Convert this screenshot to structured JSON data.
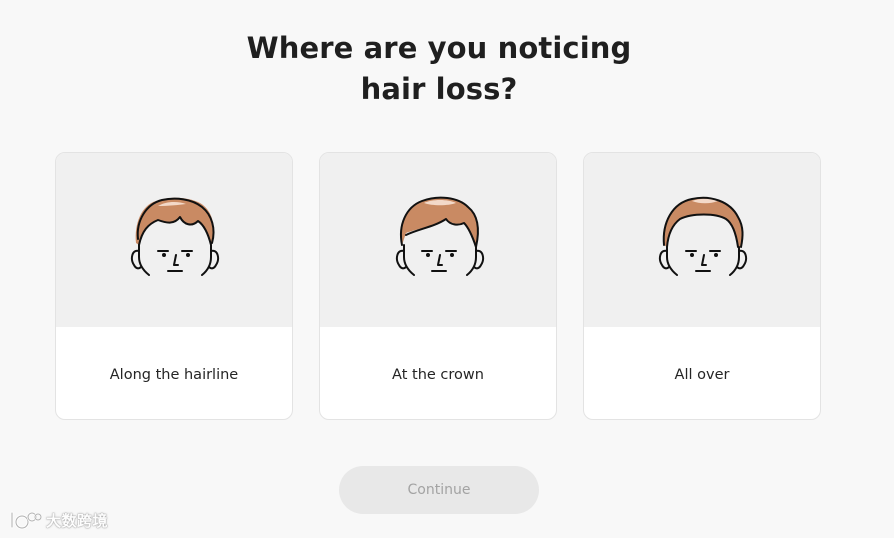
{
  "question": {
    "line1": "Where are you noticing",
    "line2": "hair loss?"
  },
  "options": [
    {
      "label": "Along the hairline",
      "icon": "face-receding-hairline-icon"
    },
    {
      "label": "At the crown",
      "icon": "face-thinning-crown-icon"
    },
    {
      "label": "All over",
      "icon": "face-overall-thinning-icon"
    }
  ],
  "continue": {
    "label": "Continue",
    "state": "disabled"
  },
  "watermark": {
    "text": "大数跨境"
  },
  "colors": {
    "page_background": "#f8f8f8",
    "hair": "#c98a63",
    "hair_highlight": "#f3d9c9",
    "outline": "#111111",
    "illustration_background": "#f0f0f0",
    "button_disabled_bg": "#e8e8e8",
    "button_disabled_text": "#a3a3a3"
  }
}
